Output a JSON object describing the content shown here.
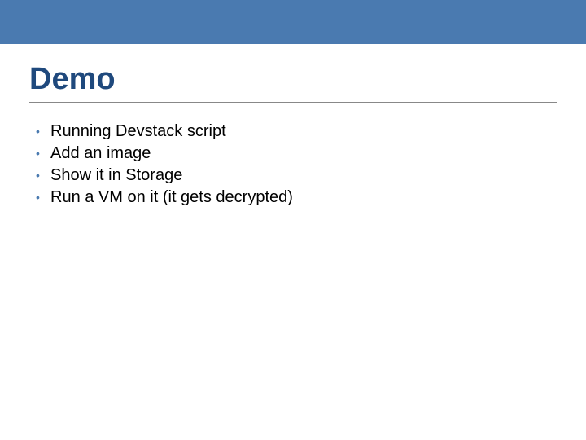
{
  "slide": {
    "title": "Demo",
    "bullets": [
      "Running Devstack script",
      "Add an image",
      "Show it in Storage",
      "Run a VM on it (it gets decrypted)"
    ]
  },
  "colors": {
    "accent": "#4a7ab0",
    "title": "#1f497d"
  }
}
